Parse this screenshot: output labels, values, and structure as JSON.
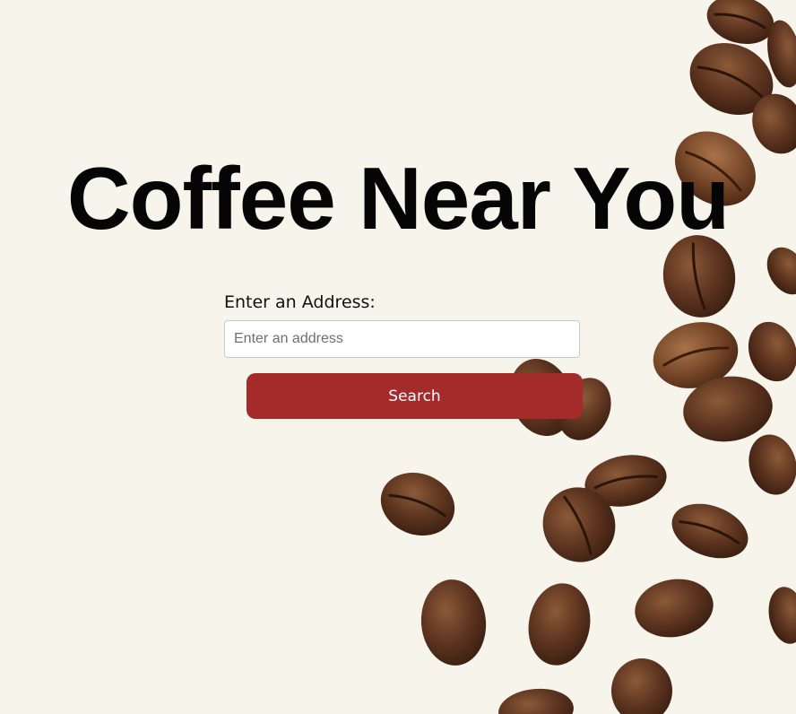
{
  "page": {
    "title": "Coffee Near You"
  },
  "search": {
    "label": "Enter an Address:",
    "placeholder": "Enter an address",
    "value": "",
    "button_label": "Search"
  },
  "colors": {
    "background": "#f7f4ec",
    "button": "#a52a2a",
    "button_text": "#ffffff",
    "title": "#050505"
  },
  "background_image": {
    "icon": "coffee-beans"
  }
}
